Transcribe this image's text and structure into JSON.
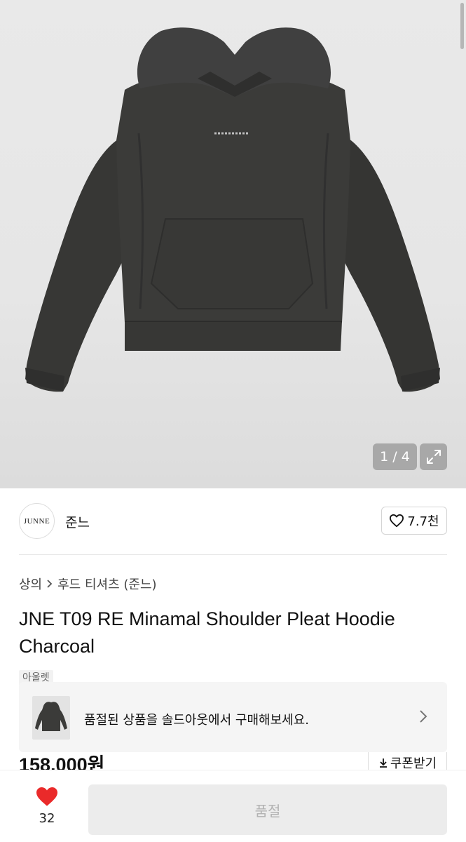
{
  "gallery": {
    "counter": "1 / 4",
    "background_color": "#e8e8e8",
    "product_color": "#3b3b39"
  },
  "seller": {
    "logo_text": "JUNNE",
    "name": "준느",
    "follow_count": "7.7천"
  },
  "breadcrumb": {
    "category": "상의",
    "subcategory": "후드 티셔츠 (준느)"
  },
  "product": {
    "title": "JNE T09 RE Minamal Shoulder Pleat Hoodie Charcoal",
    "tag": "아울렛",
    "price": "158,000원"
  },
  "banner": {
    "text": "품절된 상품을 솔드아웃에서 구매해보세요."
  },
  "coupon": {
    "label": "쿠폰받기"
  },
  "bottom_bar": {
    "like_count": "32",
    "like_color": "#ea2a2a",
    "action_label": "품절"
  }
}
